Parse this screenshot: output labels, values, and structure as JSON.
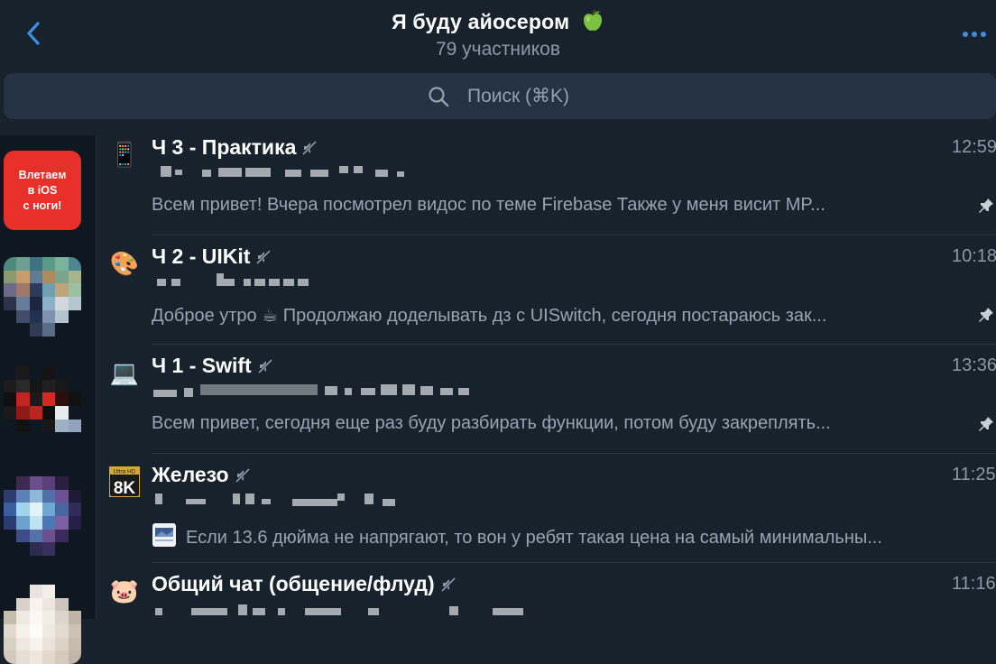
{
  "header": {
    "title": "Я буду айосером",
    "subtitle": "79 участников"
  },
  "search": {
    "placeholder": "Поиск (⌘K)"
  },
  "sidebar": {
    "folders": [
      {
        "label": "Влетаем\nв iOS\nс ноги!"
      }
    ]
  },
  "chats": [
    {
      "name": "Ч 3 - Практика",
      "time": "12:59",
      "preview": "Всем привет!  Вчера посмотрел видос по теме Firebase   Также у меня висит MP...",
      "icon": "📱",
      "pinned": true
    },
    {
      "name": "Ч 2 - UIKit",
      "time": "10:18",
      "preview": "Доброе утро ☕  Продолжаю доделывать дз с UISwitch, сегодня постараюсь зак...",
      "icon": "🎨",
      "pinned": true
    },
    {
      "name": "Ч 1 - Swift",
      "time": "13:36",
      "preview": "Всем привет, сегодня еще раз буду разбирать функции, потом буду закреплять...",
      "icon": "💻",
      "pinned": true
    },
    {
      "name": "Железо",
      "time": "11:25",
      "preview": "Если 13.6 дюйма не напрягают, то вон у ребят такая цена на самый минимальны...",
      "icon": "8K",
      "pinned": false
    },
    {
      "name": "Общий чат (общение/флуд)",
      "time": "11:16",
      "preview": "",
      "icon": "🐷",
      "pinned": false
    }
  ]
}
